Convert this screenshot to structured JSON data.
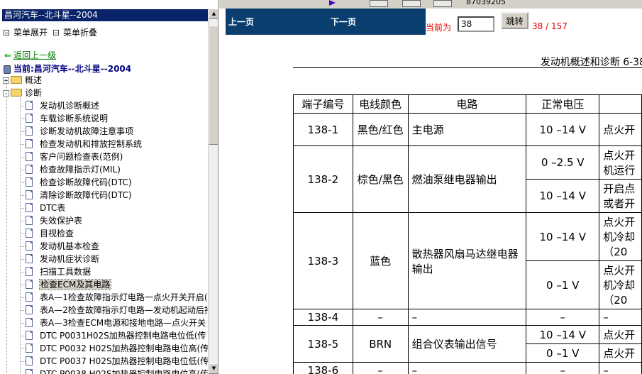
{
  "left_pane": {
    "title": "昌河汽车--北斗星--2004",
    "expand_all": "菜单展开",
    "collapse_all": "菜单折叠",
    "back_link": "返回上一级",
    "current": "当前:昌河汽车--北斗星--2004",
    "folders": [
      {
        "label": "概述",
        "expander": "+"
      },
      {
        "label": "诊断",
        "expander": "-"
      }
    ],
    "items": [
      "发动机诊断概述",
      "车载诊断系统说明",
      "诊断发动机故障注意事项",
      "检查发动机和排放控制系统",
      "客户问题检查表(范例)",
      "检查故障指示灯(MIL)",
      "检查诊断故障代码(DTC)",
      "清除诊断故障代码(DTC)",
      "DTC表",
      "失效保护表",
      "目视检查",
      "发动机基本检查",
      "发动机症状诊断",
      "扫描工具数据",
      "检查ECM及其电路",
      "表A—1检查故障指示灯电路一点火开关开启(",
      "表A—2检查故障指示灯电路—发动机起动后持",
      "表A—3检查ECM电源和接地电路—点火开关",
      "DTC P0031H02S加热器控制电路电位低(传",
      "DTC P0032 H02S加热器控制电路电位高(传",
      "DTC P0037 H02S加热器控制电路电位低(传",
      "DTC P0038 H02S加热器控制电路电位高(传"
    ],
    "selected_index": 14
  },
  "toolbar": {
    "number": "87039205"
  },
  "nav": {
    "prev": "上一页",
    "next": "下一页",
    "current_label": "当前为",
    "page_value": "38",
    "jump": "跳转",
    "total": "38 / 157"
  },
  "document": {
    "header": "发动机概述和诊断 6-38",
    "table_headers": [
      "端子编号",
      "电线颜色",
      "电路",
      "正常电压",
      ""
    ],
    "rows": [
      {
        "terminal": "138-1",
        "color": "黑色/红色",
        "circuit": "主电源",
        "voltage": "10 –14 V",
        "condition": "点火开"
      },
      {
        "terminal": "138-2",
        "color": "棕色/黑色",
        "circuit": "燃油泵继电器输出",
        "voltage": "0 –2.5 V",
        "condition": "点火开\n机运行"
      },
      {
        "terminal": "",
        "color": "",
        "circuit": "",
        "voltage": "10 –14 V",
        "condition": "开启点\n或者开"
      },
      {
        "terminal": "138-3",
        "color": "蓝色",
        "circuit": "散热器风扇马达继电器输出",
        "voltage": "10 –14 V",
        "condition": "点火开\n机冷却\n（20"
      },
      {
        "terminal": "",
        "color": "",
        "circuit": "",
        "voltage": "0 –1 V",
        "condition": "点火开\n机冷却\n（20"
      },
      {
        "terminal": "138-4",
        "color": "–",
        "circuit": "–",
        "voltage": "–",
        "condition": "–"
      },
      {
        "terminal": "138-5",
        "color": "BRN",
        "circuit": "组合仪表输出信号",
        "voltage": "10 –14 V",
        "condition": "点火开"
      },
      {
        "terminal": "",
        "color": "",
        "circuit": "",
        "voltage": "0 –1 V",
        "condition": "点火开"
      },
      {
        "terminal": "138-6",
        "color": "–",
        "circuit": "–",
        "voltage": "–",
        "condition": "–"
      }
    ]
  },
  "colors": {
    "title_bar": "#0a246a",
    "nav_bar": "#0a3e6e",
    "page_text": "#e00000",
    "back_link": "#008000",
    "current_text": "#000080"
  }
}
